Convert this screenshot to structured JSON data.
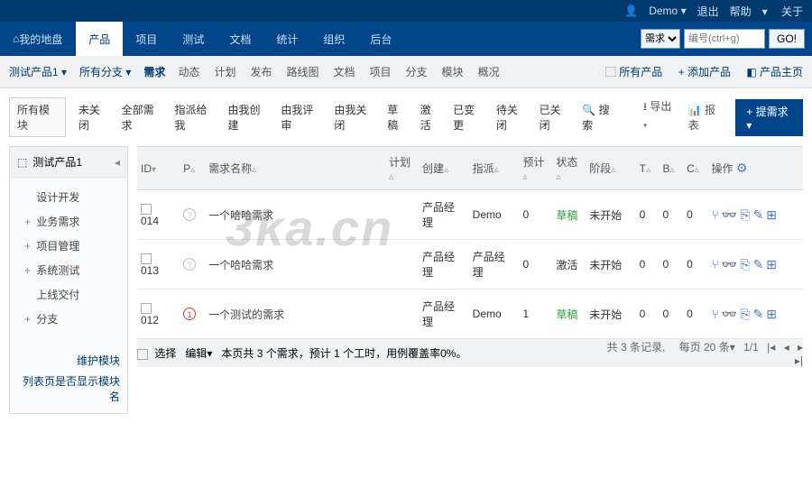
{
  "topbar": {
    "user": "Demo",
    "logout": "退出",
    "help": "帮助",
    "about": "关于"
  },
  "nav": {
    "dashboard": "我的地盘",
    "product": "产品",
    "project": "项目",
    "test": "测试",
    "doc": "文档",
    "stats": "统计",
    "org": "组织",
    "admin": "后台"
  },
  "search": {
    "type": "需求",
    "placeholder": "编号(ctrl+g)",
    "go": "GO!"
  },
  "subnav": {
    "product_drop": "测试产品1",
    "branch_drop": "所有分支",
    "items": [
      "需求",
      "动态",
      "计划",
      "发布",
      "路线图",
      "文档",
      "项目",
      "分支",
      "模块",
      "概况"
    ],
    "right": {
      "all": "所有产品",
      "add": "添加产品",
      "home": "产品主页"
    }
  },
  "toolbar": {
    "all_modules": "所有模块",
    "filters": [
      "未关闭",
      "全部需求",
      "指派给我",
      "由我创建",
      "由我评审",
      "由我关闭",
      "草稿",
      "激活",
      "已变更",
      "待关闭",
      "已关闭"
    ],
    "search": "搜索",
    "export": "导出",
    "report": "报表",
    "add_req": "提需求"
  },
  "sidebar": {
    "title": "测试产品1",
    "items": [
      {
        "exp": "",
        "label": "设计开发"
      },
      {
        "exp": "+",
        "label": "业务需求"
      },
      {
        "exp": "+",
        "label": "项目管理"
      },
      {
        "exp": "+",
        "label": "系统测试"
      },
      {
        "exp": "",
        "label": "上线交付"
      },
      {
        "exp": "+",
        "label": "分支"
      }
    ],
    "maint": "维护模块",
    "showname": "列表页是否显示模块名"
  },
  "table": {
    "cols": {
      "id": "ID",
      "p": "P",
      "name": "需求名称",
      "plan": "计划",
      "creator": "创建",
      "assign": "指派",
      "est": "预计",
      "status": "状态",
      "stage": "阶段",
      "t": "T",
      "b": "B",
      "c": "C",
      "ops": "操作"
    },
    "rows": [
      {
        "id": "014",
        "pri": "?",
        "name": "一个哈哈需求",
        "creator": "产品经理",
        "assign": "Demo",
        "est": "0",
        "status": "草稿",
        "status_cls": "status-draft",
        "stage": "未开始",
        "t": "0",
        "b": "0",
        "c": "0"
      },
      {
        "id": "013",
        "pri": "?",
        "name": "一个哈哈需求",
        "creator": "产品经理",
        "assign": "产品经理",
        "est": "0",
        "status": "激活",
        "status_cls": "status-active",
        "stage": "未开始",
        "t": "0",
        "b": "0",
        "c": "0"
      },
      {
        "id": "012",
        "pri": "1",
        "name": "一个测试的需求",
        "creator": "产品经理",
        "assign": "Demo",
        "est": "1",
        "status": "草稿",
        "status_cls": "status-draft",
        "stage": "未开始",
        "t": "0",
        "b": "0",
        "c": "0"
      }
    ],
    "footer": {
      "select": "选择",
      "edit": "编辑",
      "summary": "本页共 3 个需求，预计 1 个工时，用例覆盖率0%。",
      "total": "共 3 条记录",
      "perpage": "每页 20 条",
      "pages": "1/1"
    }
  },
  "watermark": "3ka.cn"
}
